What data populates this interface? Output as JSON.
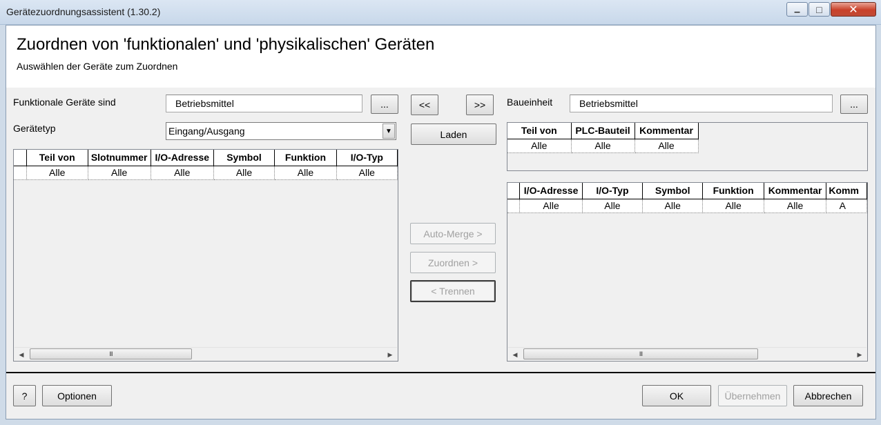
{
  "window": {
    "title": "Gerätezuordnungsassistent (1.30.2)",
    "minimize_glyph": "▁",
    "maximize_glyph": "□",
    "close_glyph": "✕"
  },
  "header": {
    "title": "Zuordnen von 'funktionalen' und 'physikalischen' Geräten",
    "subtitle": "Auswählen der Geräte zum Zuordnen"
  },
  "left": {
    "functional_label": "Funktionale Geräte sind",
    "functional_value": "Betriebsmittel",
    "browse_label": "...",
    "device_type_label": "Gerätetyp",
    "device_type_value": "Eingang/Ausgang",
    "grid": {
      "columns": [
        "Teil von",
        "Slotnummer",
        "I/O-Adresse",
        "Symbol",
        "Funktion",
        "I/O-Typ"
      ],
      "filter_row": [
        "Alle",
        "Alle",
        "Alle",
        "Alle",
        "Alle",
        "Alle"
      ]
    }
  },
  "middle": {
    "move_left_label": "<<",
    "move_right_label": ">>",
    "load_label": "Laden",
    "auto_merge_label": "Auto-Merge >",
    "assign_label": "Zuordnen >",
    "separate_label": "< Trennen"
  },
  "right": {
    "unit_label": "Baueinheit",
    "unit_value": "Betriebsmittel",
    "browse_label": "...",
    "top_grid": {
      "columns": [
        "Teil von",
        "PLC-Bauteil",
        "Kommentar"
      ],
      "filter_row": [
        "Alle",
        "Alle",
        "Alle"
      ]
    },
    "bottom_grid": {
      "columns": [
        "I/O-Adresse",
        "I/O-Typ",
        "Symbol",
        "Funktion",
        "Kommentar",
        "Komm"
      ],
      "filter_row": [
        "Alle",
        "Alle",
        "Alle",
        "Alle",
        "Alle",
        "A"
      ]
    }
  },
  "scrollbar": {
    "left_arrow": "◀",
    "right_arrow": "▶",
    "grip": "III"
  },
  "footer": {
    "help_label": "?",
    "options_label": "Optionen",
    "ok_label": "OK",
    "apply_label": "Übernehmen",
    "cancel_label": "Abbrechen"
  }
}
